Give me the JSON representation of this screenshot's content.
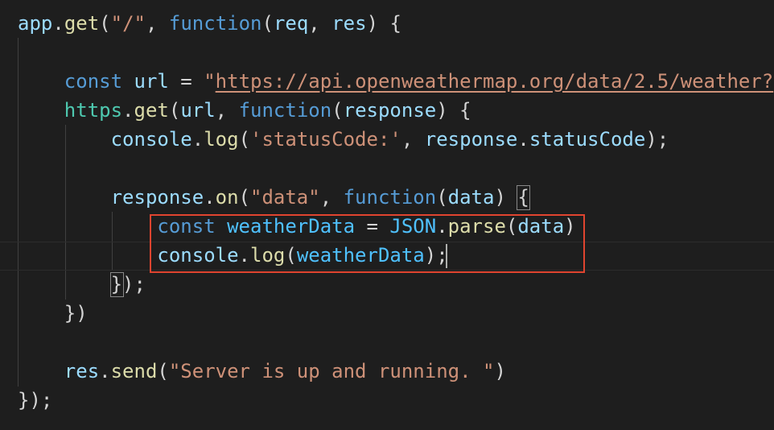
{
  "editor": {
    "lines": [
      [
        {
          "t": "app",
          "c": "variable"
        },
        {
          "t": ".",
          "c": "punct"
        },
        {
          "t": "get",
          "c": "function"
        },
        {
          "t": "(",
          "c": "punct"
        },
        {
          "t": "\"/\"",
          "c": "string"
        },
        {
          "t": ", ",
          "c": "punct"
        },
        {
          "t": "function",
          "c": "keyword"
        },
        {
          "t": "(",
          "c": "punct"
        },
        {
          "t": "req",
          "c": "param"
        },
        {
          "t": ", ",
          "c": "punct"
        },
        {
          "t": "res",
          "c": "param"
        },
        {
          "t": ") {",
          "c": "punct"
        }
      ],
      [],
      [
        {
          "t": "    ",
          "c": "punct"
        },
        {
          "t": "const",
          "c": "keyword"
        },
        {
          "t": " ",
          "c": "punct"
        },
        {
          "t": "url",
          "c": "variable"
        },
        {
          "t": " = ",
          "c": "punct"
        },
        {
          "t": "\"",
          "c": "string"
        },
        {
          "t": "https://api.openweathermap.org/data/2.5/weather?",
          "c": "url"
        }
      ],
      [
        {
          "t": "    ",
          "c": "punct"
        },
        {
          "t": "https",
          "c": "class"
        },
        {
          "t": ".",
          "c": "punct"
        },
        {
          "t": "get",
          "c": "function"
        },
        {
          "t": "(",
          "c": "punct"
        },
        {
          "t": "url",
          "c": "variable"
        },
        {
          "t": ", ",
          "c": "punct"
        },
        {
          "t": "function",
          "c": "keyword"
        },
        {
          "t": "(",
          "c": "punct"
        },
        {
          "t": "response",
          "c": "param"
        },
        {
          "t": ") {",
          "c": "punct"
        }
      ],
      [
        {
          "t": "        ",
          "c": "punct"
        },
        {
          "t": "console",
          "c": "variable"
        },
        {
          "t": ".",
          "c": "punct"
        },
        {
          "t": "log",
          "c": "function"
        },
        {
          "t": "(",
          "c": "punct"
        },
        {
          "t": "'statusCode:'",
          "c": "string"
        },
        {
          "t": ", ",
          "c": "punct"
        },
        {
          "t": "response",
          "c": "variable"
        },
        {
          "t": ".",
          "c": "punct"
        },
        {
          "t": "statusCode",
          "c": "variable"
        },
        {
          "t": ");",
          "c": "punct"
        }
      ],
      [],
      [
        {
          "t": "        ",
          "c": "punct"
        },
        {
          "t": "response",
          "c": "variable"
        },
        {
          "t": ".",
          "c": "punct"
        },
        {
          "t": "on",
          "c": "function"
        },
        {
          "t": "(",
          "c": "punct"
        },
        {
          "t": "\"data\"",
          "c": "string"
        },
        {
          "t": ", ",
          "c": "punct"
        },
        {
          "t": "function",
          "c": "keyword"
        },
        {
          "t": "(",
          "c": "punct"
        },
        {
          "t": "data",
          "c": "param"
        },
        {
          "t": ") {",
          "c": "punct"
        }
      ],
      [
        {
          "t": "            ",
          "c": "punct"
        },
        {
          "t": "const",
          "c": "keyword"
        },
        {
          "t": " ",
          "c": "punct"
        },
        {
          "t": "weatherData",
          "c": "constant"
        },
        {
          "t": " = ",
          "c": "punct"
        },
        {
          "t": "JSON",
          "c": "constant"
        },
        {
          "t": ".",
          "c": "punct"
        },
        {
          "t": "parse",
          "c": "function"
        },
        {
          "t": "(",
          "c": "punct"
        },
        {
          "t": "data",
          "c": "variable"
        },
        {
          "t": ")",
          "c": "punct"
        }
      ],
      [
        {
          "t": "            ",
          "c": "punct"
        },
        {
          "t": "console",
          "c": "variable"
        },
        {
          "t": ".",
          "c": "punct"
        },
        {
          "t": "log",
          "c": "function"
        },
        {
          "t": "(",
          "c": "punct"
        },
        {
          "t": "weatherData",
          "c": "constant"
        },
        {
          "t": ");",
          "c": "punct"
        }
      ],
      [
        {
          "t": "        ",
          "c": "punct"
        },
        {
          "t": "});",
          "c": "punct"
        }
      ],
      [
        {
          "t": "    ",
          "c": "punct"
        },
        {
          "t": "})",
          "c": "punct"
        }
      ],
      [],
      [
        {
          "t": "    ",
          "c": "punct"
        },
        {
          "t": "res",
          "c": "variable"
        },
        {
          "t": ".",
          "c": "punct"
        },
        {
          "t": "send",
          "c": "function"
        },
        {
          "t": "(",
          "c": "punct"
        },
        {
          "t": "\"Server is up and running. \"",
          "c": "string"
        },
        {
          "t": ")",
          "c": "punct"
        }
      ],
      [
        {
          "t": "});",
          "c": "punct"
        }
      ]
    ]
  }
}
